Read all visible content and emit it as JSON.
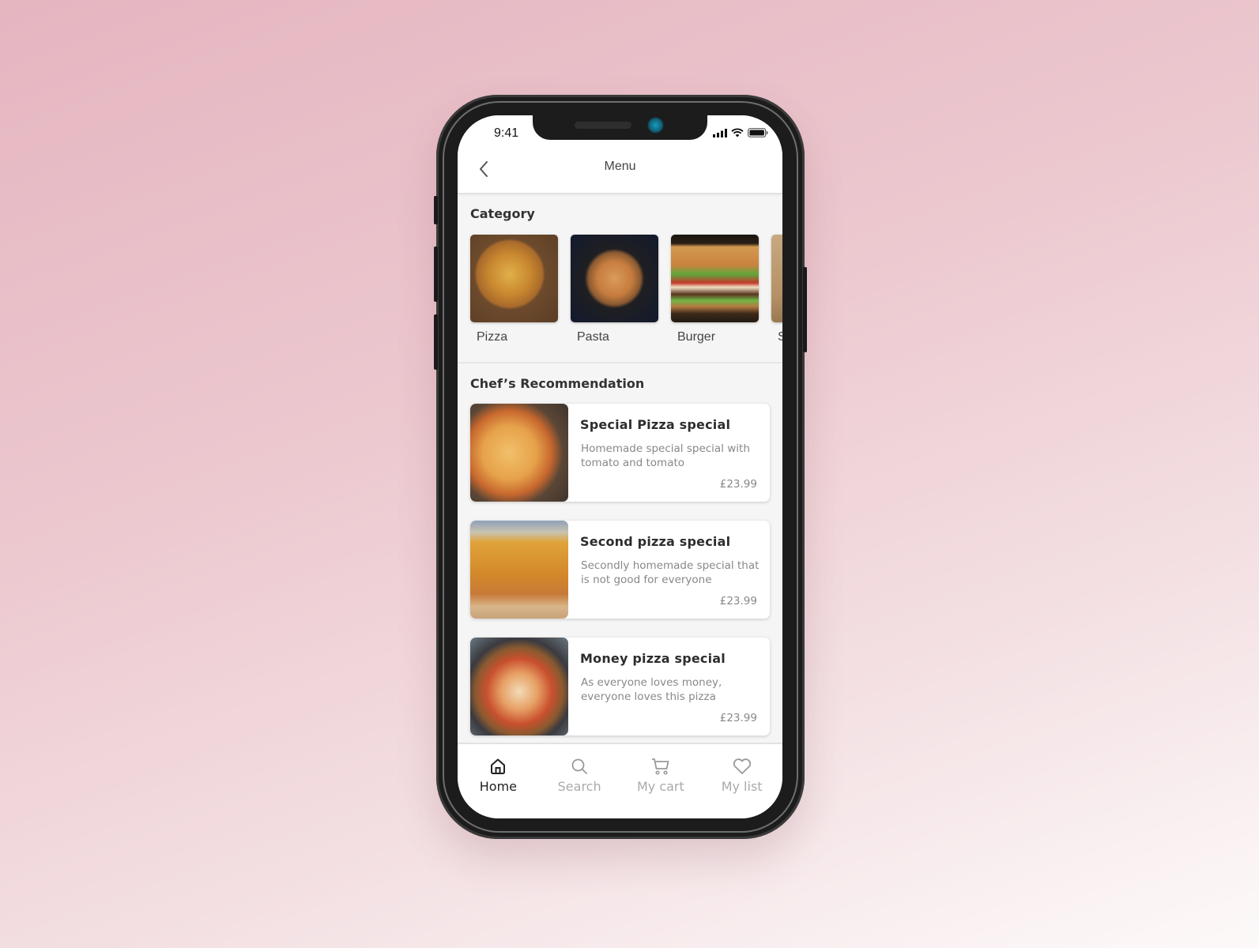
{
  "status_bar": {
    "time": "9:41"
  },
  "header": {
    "title": "Menu",
    "back_icon": "chevron-left-icon"
  },
  "category": {
    "title": "Category",
    "items": [
      {
        "label": "Pizza",
        "image": "pizza-photo"
      },
      {
        "label": "Pasta",
        "image": "pasta-photo"
      },
      {
        "label": "Burger",
        "image": "burger-photo"
      },
      {
        "label": "S",
        "image": "sandwich-photo"
      }
    ]
  },
  "recommendation": {
    "title": "Chef’s Recommendation",
    "items": [
      {
        "name": "Special Pizza special",
        "description": "Homemade special special with tomato and tomato",
        "price": "£23.99"
      },
      {
        "name": "Second pizza special",
        "description": "Secondly homemade special that is not good for everyone",
        "price": "£23.99"
      },
      {
        "name": "Money pizza special",
        "description": "As everyone loves money, everyone loves this pizza",
        "price": "£23.99"
      }
    ]
  },
  "tabbar": {
    "active": "Home",
    "items": [
      {
        "label": "Home",
        "icon": "home-icon"
      },
      {
        "label": "Search",
        "icon": "search-icon"
      },
      {
        "label": "My cart",
        "icon": "cart-icon"
      },
      {
        "label": "My list",
        "icon": "heart-icon"
      }
    ]
  },
  "colors": {
    "active_tab": "#222222",
    "inactive_tab": "#aaaaaa",
    "background_top": "#e5b5c0"
  }
}
